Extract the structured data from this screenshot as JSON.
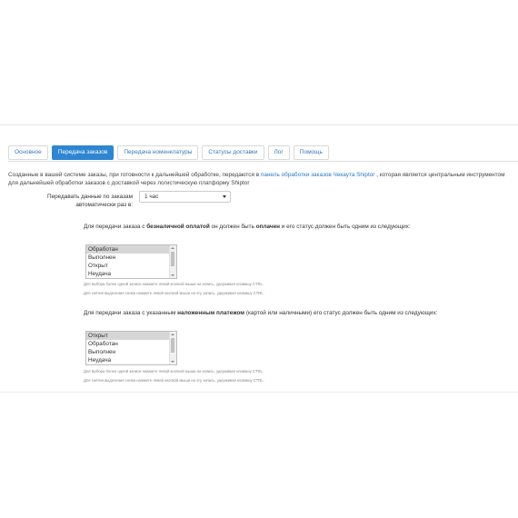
{
  "tabs": [
    {
      "label": "Основное",
      "active": false
    },
    {
      "label": "Передача заказов",
      "active": true
    },
    {
      "label": "Передача номенклатуры",
      "active": false
    },
    {
      "label": "Статусы доставки",
      "active": false
    },
    {
      "label": "Лог",
      "active": false
    },
    {
      "label": "Помощь",
      "active": false
    }
  ],
  "description": {
    "before": "Созданные в вашей системе заказы, при готовности к дальнейшей обработке, передаются в",
    "link": "панель обработки заказов Чекаута Shiptor",
    "after": ", которая является центральным инструментом для дальнейшей обработки заказов с доставкой через логистическую платформу Shiptor"
  },
  "transfer": {
    "label": "Передавать данные по заказам автоматически раз в:",
    "value": "1 час"
  },
  "cashless": {
    "pre": "Для передачи заказа с ",
    "bold1": "безналичной оплатой",
    "mid": " он должен быть ",
    "bold2": "оплачен",
    "post": " и его статус должен быть одним из следующих:",
    "options": [
      "Обработан",
      "Выполнен",
      "Открыт",
      "Неудача"
    ],
    "selected": "Обработан",
    "hint1": "Для выбора более одной записи нажмите левой кнопкой мыши на запись, удерживая клавишу CTRL.",
    "hint2": "Для снятия выделения снова нажмите левой кнопкой мыши на эту запись, удерживая клавишу CTRL."
  },
  "cod": {
    "pre": "Для передачи заказа с указанным ",
    "bold1": "наложенным платежом",
    "post": " (картой или наличными) его статус должен быть одним из следующих:",
    "options": [
      "Открыт",
      "Обработан",
      "Выполнен",
      "Неудача"
    ],
    "selected": "Открыт",
    "hint1": "Для выбора более одной записи нажмите левой кнопкой мыши на запись, удерживая клавишу CTRL.",
    "hint2": "Для снятия выделения снова нажмите левой кнопкой мыши на эту запись, удерживая клавишу CTRL."
  }
}
